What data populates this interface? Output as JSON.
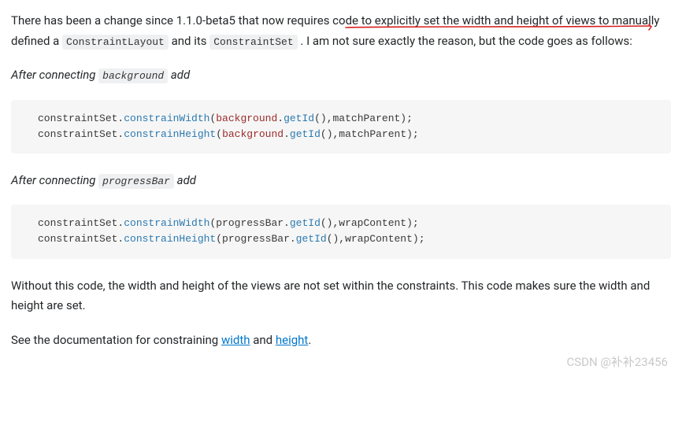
{
  "para1": {
    "t1": "There has been a change since 1.1.0-beta5 that now requires code to explicitly set the width and height of views to manually defined a ",
    "code1": "ConstraintLayout",
    "t2": " and its ",
    "code2": "ConstraintSet",
    "t3": ". I am not sure exactly the reason, but the code goes as follows:"
  },
  "after_bg": {
    "t1": "After connecting ",
    "code": "background",
    "t2": " add"
  },
  "code_bg": {
    "l1a": "constraintSet.",
    "l1b": "constrainWidth",
    "l1c": "(",
    "l1d": "background",
    "l1e": ".",
    "l1f": "getId",
    "l1g": "(),matchParent);",
    "l2a": "constraintSet.",
    "l2b": "constrainHeight",
    "l2c": "(",
    "l2d": "background",
    "l2e": ".",
    "l2f": "getId",
    "l2g": "(),matchParent);"
  },
  "after_pb": {
    "t1": "After connecting ",
    "code": "progressBar",
    "t2": " add"
  },
  "code_pb": {
    "l1a": "constraintSet.",
    "l1b": "constrainWidth",
    "l1c": "(progressBar.",
    "l1d": "getId",
    "l1e": "(),wrapContent);",
    "l2a": "constraintSet.",
    "l2b": "constrainHeight",
    "l2c": "(progressBar.",
    "l2d": "getId",
    "l2e": "(),wrapContent);"
  },
  "para2": "Without this code, the width and height of the views are not set within the constraints. This code makes sure the width and height are set.",
  "para3": {
    "t1": "See the documentation for constraining ",
    "link1": "width",
    "t2": " and ",
    "link2": "height",
    "t3": "."
  },
  "watermark": "CSDN @补补23456"
}
